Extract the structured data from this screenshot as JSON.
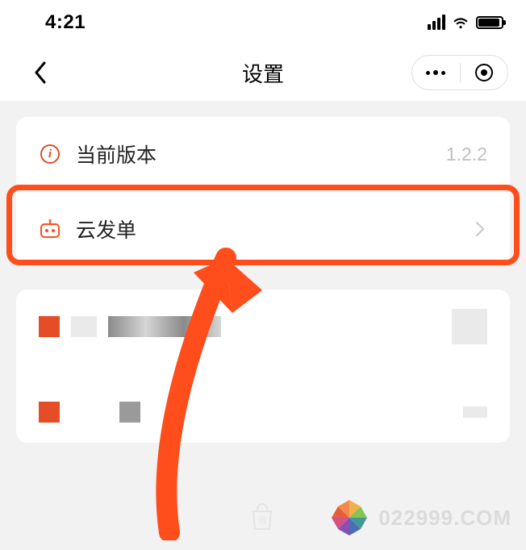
{
  "status": {
    "time": "4:21"
  },
  "nav": {
    "title": "设置"
  },
  "settings": {
    "rows": [
      {
        "label": "当前版本",
        "value": "1.2.2"
      },
      {
        "label": "云发单"
      }
    ]
  },
  "watermark": {
    "text": "022999.COM"
  },
  "annotation": {
    "highlight_color": "#ff4d1c"
  }
}
